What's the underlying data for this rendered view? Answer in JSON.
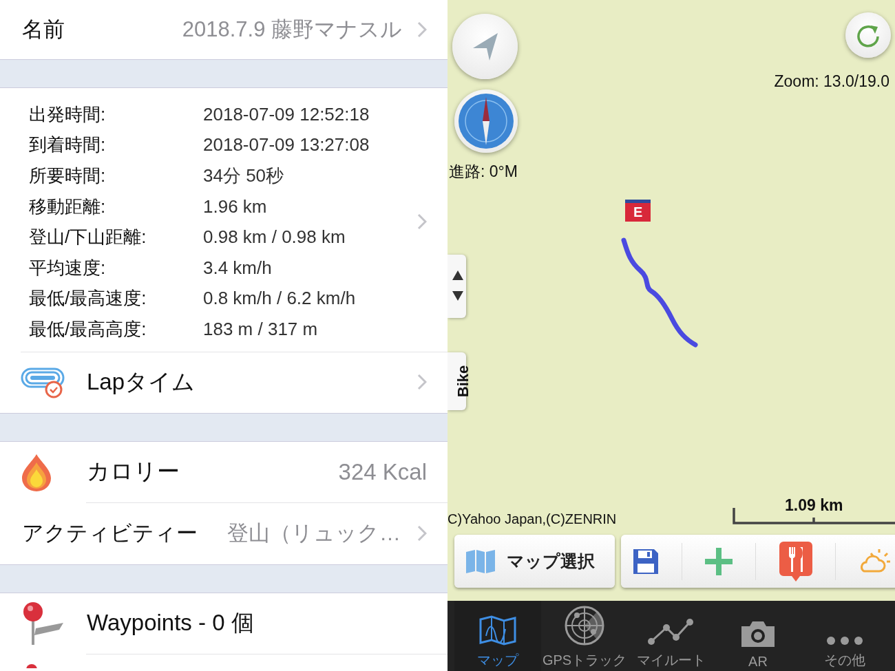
{
  "name_row": {
    "label": "名前",
    "value": "2018.7.9 藤野マナスル"
  },
  "stats": [
    {
      "label": "出発時間:",
      "value": "2018-07-09 12:52:18"
    },
    {
      "label": "到着時間:",
      "value": "2018-07-09 13:27:08"
    },
    {
      "label": "所要時間:",
      "value": "34分 50秒"
    },
    {
      "label": "移動距離:",
      "value": "1.96 km"
    },
    {
      "label": "登山/下山距離:",
      "value": "0.98 km / 0.98 km"
    },
    {
      "label": "平均速度:",
      "value": "3.4 km/h"
    },
    {
      "label": "最低/最高速度:",
      "value": "0.8 km/h / 6.2 km/h"
    },
    {
      "label": "最低/最高高度:",
      "value": "183 m / 317 m"
    }
  ],
  "lap_row": {
    "label": "Lapタイム"
  },
  "calorie_row": {
    "label": "カロリー",
    "value": "324 Kcal"
  },
  "activity_row": {
    "label": "アクティビティー",
    "value": "登山（リュック…"
  },
  "waypoints_row": {
    "label": "Waypoints - 0 個"
  },
  "map": {
    "zoom": "Zoom: 13.0/19.0",
    "heading": "進路: 0°M",
    "end_marker": "E",
    "side_tab": "Bike",
    "copyright": "C)Yahoo Japan,(C)ZENRIN",
    "scale": "1.09 km",
    "map_select_button": "マップ選択"
  },
  "tab_bar": [
    {
      "kind": "map",
      "label": "マップ",
      "selected": true
    },
    {
      "kind": "radar",
      "label": "GPSトラック",
      "selected": false
    },
    {
      "kind": "route",
      "label": "マイルート",
      "selected": false
    },
    {
      "kind": "camera",
      "label": "AR",
      "selected": false
    },
    {
      "kind": "more",
      "label": "その他",
      "selected": false
    }
  ]
}
